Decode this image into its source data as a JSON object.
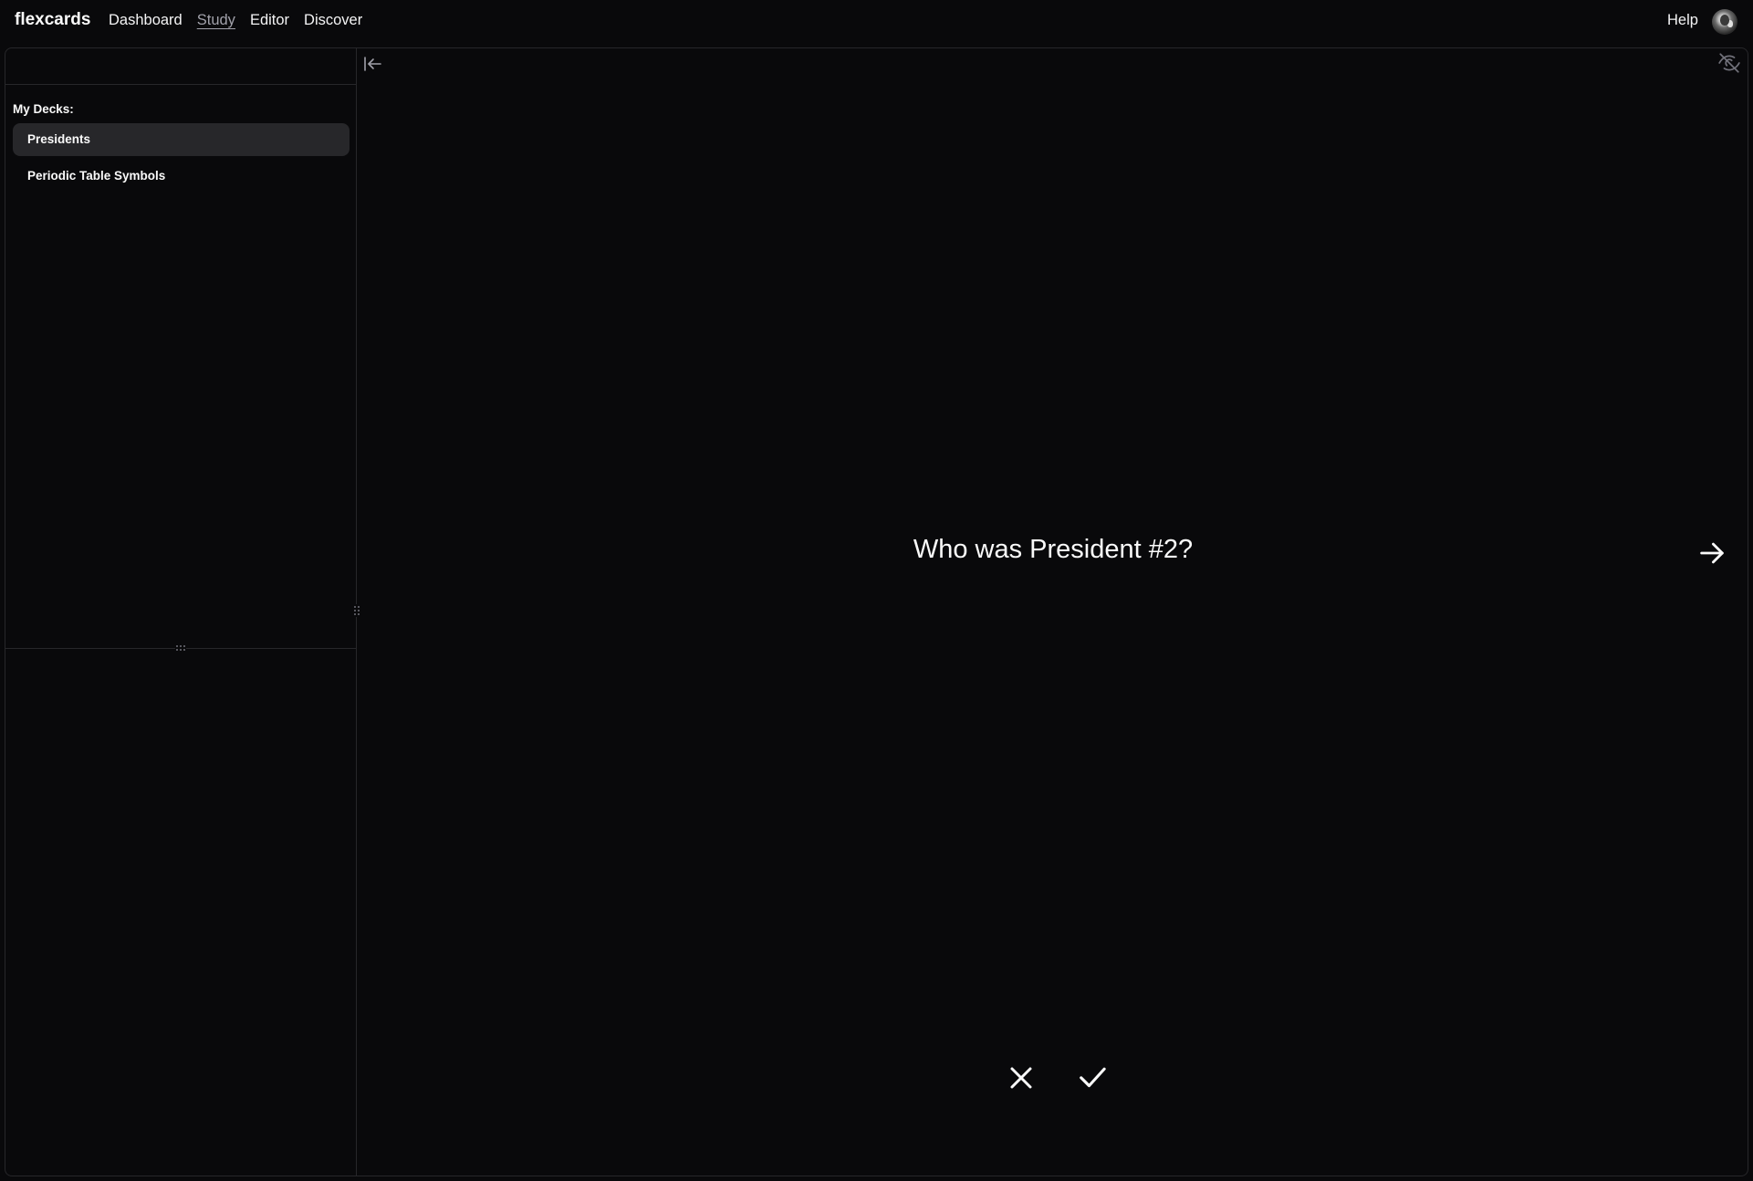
{
  "header": {
    "brand": "flexcards",
    "nav": [
      "Dashboard",
      "Study",
      "Editor",
      "Discover"
    ],
    "active_nav": "Study",
    "help_label": "Help"
  },
  "sidebar": {
    "heading": "My Decks:",
    "decks": [
      {
        "label": "Presidents",
        "selected": true
      },
      {
        "label": "Periodic Table Symbols",
        "selected": false
      }
    ]
  },
  "card": {
    "question": "Who was President #2?"
  },
  "icons": {
    "collapse": "collapse-sidebar-icon",
    "hide": "eye-off-icon",
    "next": "arrow-right-icon",
    "wrong": "x-icon",
    "right": "check-icon"
  },
  "colors": {
    "background": "#09090b",
    "border": "#27272a",
    "selected_bg": "#27272a",
    "text": "#fafafa",
    "muted": "#a1a1aa"
  }
}
